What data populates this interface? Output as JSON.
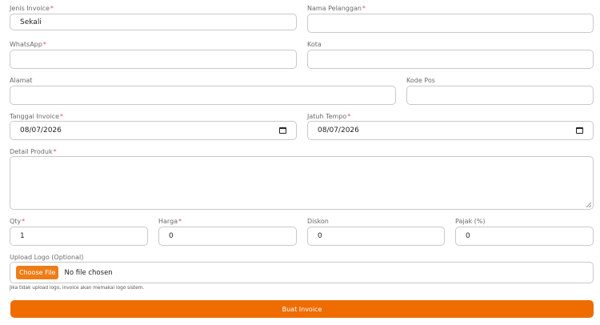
{
  "form": {
    "jenis_invoice": {
      "label": "Jenis Invoice",
      "value": "Sekali"
    },
    "nama_pelanggan": {
      "label": "Nama Pelanggan",
      "value": ""
    },
    "whatsapp": {
      "label": "WhatsApp",
      "value": ""
    },
    "kota": {
      "label": "Kota",
      "value": ""
    },
    "alamat": {
      "label": "Alamat",
      "value": ""
    },
    "kode_pos": {
      "label": "Kode Pos",
      "value": ""
    },
    "tanggal_invoice": {
      "label": "Tanggal Invoice",
      "value": "08/07/2026"
    },
    "jatuh_tempo": {
      "label": "Jatuh Tempo",
      "value": "08/07/2026"
    },
    "detail_produk": {
      "label": "Detail Produk",
      "value": ""
    },
    "qty": {
      "label": "Qty",
      "value": "1"
    },
    "harga": {
      "label": "Harga",
      "value": "0"
    },
    "diskon": {
      "label": "Diskon",
      "value": "0"
    },
    "pajak": {
      "label": "Pajak (%)",
      "value": "0"
    },
    "upload_logo": {
      "label": "Upload Logo (Optional)",
      "button_label": "Choose File",
      "status": "No file chosen",
      "hint": "Jika tidak upload logo, invoice akan memakai logo sistem."
    },
    "required_marker": "*",
    "submit_label": "Buat Invoice"
  },
  "colors": {
    "accent": "#ef6c00",
    "required": "#e8505b",
    "border": "#c9c9c9"
  },
  "icons": {
    "date_picker": "calendar-icon",
    "textarea_resize": "resize-grip-icon"
  }
}
